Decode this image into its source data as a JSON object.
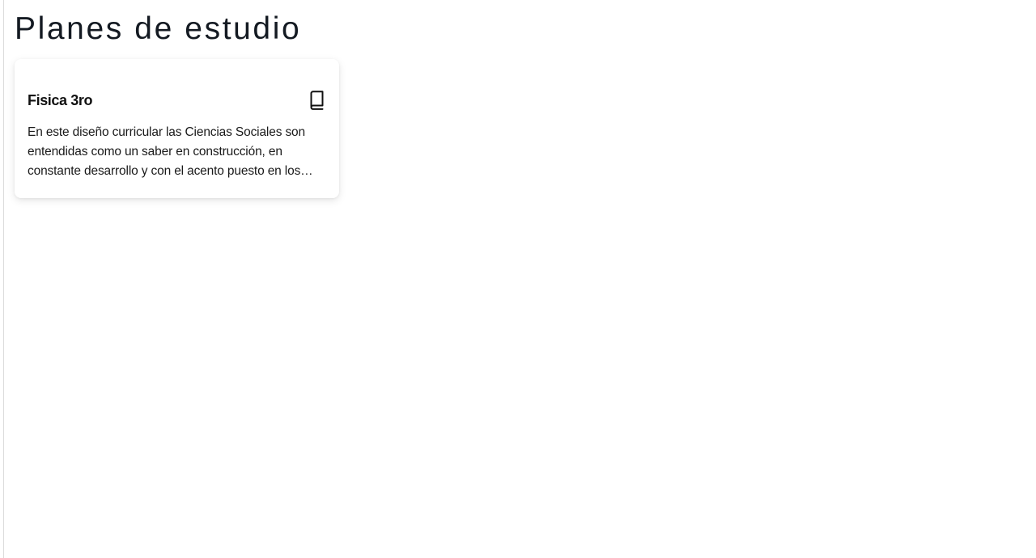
{
  "page": {
    "title": "Planes de estudio"
  },
  "cards": [
    {
      "title": "Fisica 3ro",
      "icon": "book-icon",
      "description": "En este diseño curricular las Ciencias Sociales son entendidas como un saber en construcción, en constante desarrollo y con el acento puesto en los procesos de enseñanza y aprendizaje."
    }
  ]
}
